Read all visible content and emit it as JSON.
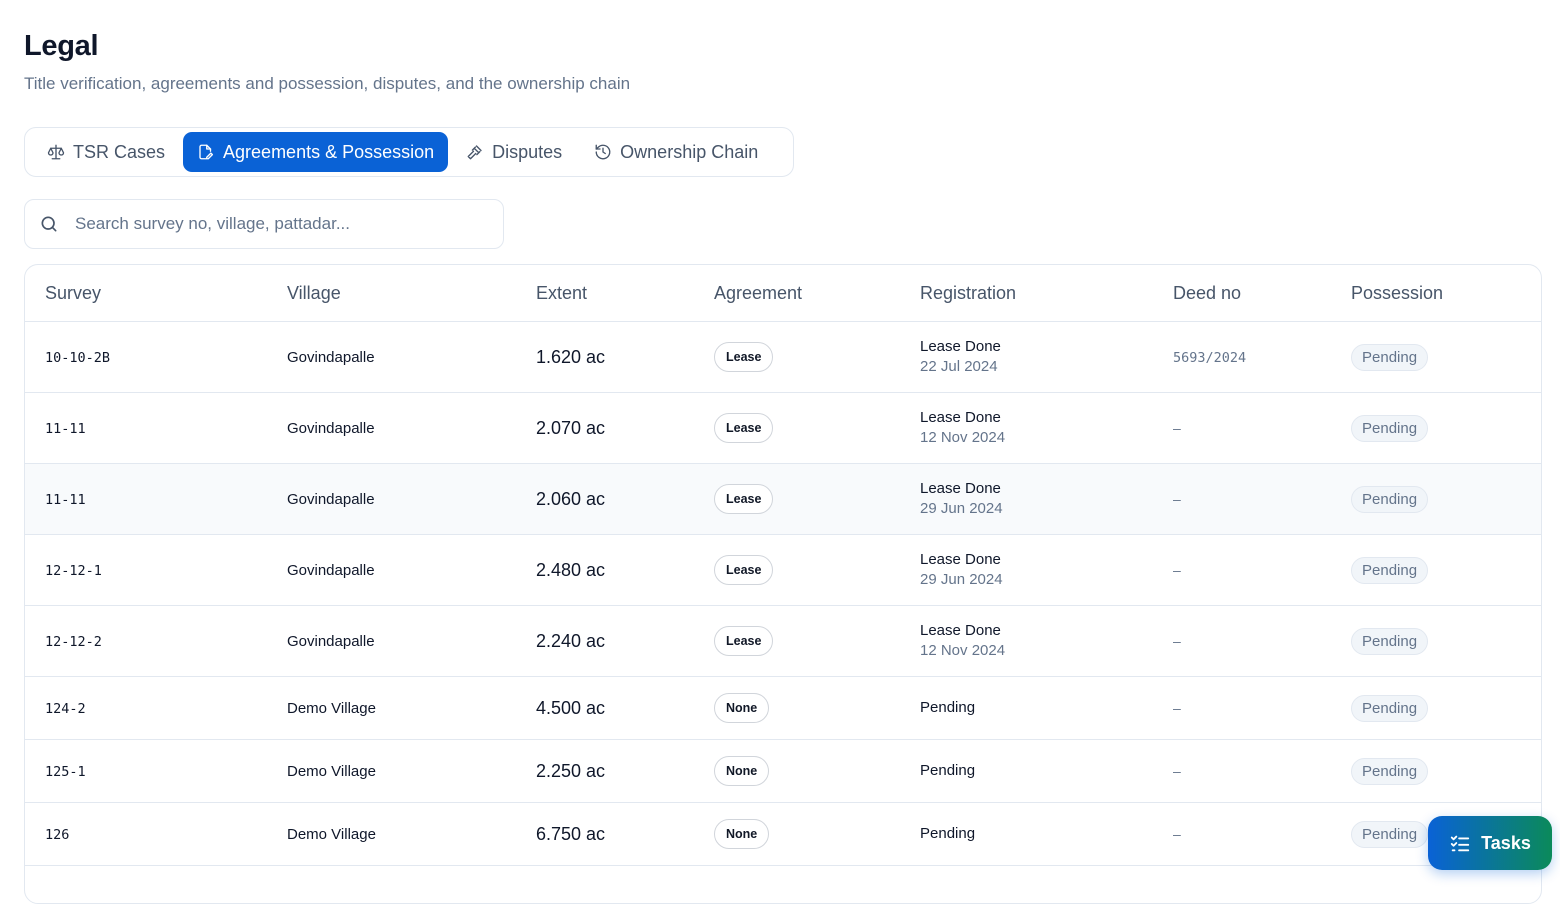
{
  "header": {
    "title": "Legal",
    "subtitle": "Title verification, agreements and possession, disputes, and the ownership chain"
  },
  "tabs": [
    {
      "label": "TSR Cases",
      "icon": "scale-icon",
      "active": false
    },
    {
      "label": "Agreements & Possession",
      "icon": "file-pen-icon",
      "active": true
    },
    {
      "label": "Disputes",
      "icon": "gavel-icon",
      "active": false
    },
    {
      "label": "Ownership Chain",
      "icon": "history-icon",
      "active": false
    }
  ],
  "search": {
    "placeholder": "Search survey no, village, pattadar...",
    "value": ""
  },
  "table": {
    "columns": [
      "Survey",
      "Village",
      "Extent",
      "Agreement",
      "Registration",
      "Deed no",
      "Possession"
    ],
    "rows": [
      {
        "survey": "10-10-2B",
        "village": "Govindapalle",
        "extent": "1.620 ac",
        "agreement": "Lease",
        "registration": "Lease Done",
        "reg_date": "22 Jul 2024",
        "deed": "5693/2024",
        "possession": "Pending"
      },
      {
        "survey": "11-11",
        "village": "Govindapalle",
        "extent": "2.070 ac",
        "agreement": "Lease",
        "registration": "Lease Done",
        "reg_date": "12 Nov 2024",
        "deed": "–",
        "possession": "Pending"
      },
      {
        "survey": "11-11",
        "village": "Govindapalle",
        "extent": "2.060 ac",
        "agreement": "Lease",
        "registration": "Lease Done",
        "reg_date": "29 Jun 2024",
        "deed": "–",
        "possession": "Pending"
      },
      {
        "survey": "12-12-1",
        "village": "Govindapalle",
        "extent": "2.480 ac",
        "agreement": "Lease",
        "registration": "Lease Done",
        "reg_date": "29 Jun 2024",
        "deed": "–",
        "possession": "Pending"
      },
      {
        "survey": "12-12-2",
        "village": "Govindapalle",
        "extent": "2.240 ac",
        "agreement": "Lease",
        "registration": "Lease Done",
        "reg_date": "12 Nov 2024",
        "deed": "–",
        "possession": "Pending"
      },
      {
        "survey": "124-2",
        "village": "Demo Village",
        "extent": "4.500 ac",
        "agreement": "None",
        "registration": "Pending",
        "reg_date": "",
        "deed": "–",
        "possession": "Pending"
      },
      {
        "survey": "125-1",
        "village": "Demo Village",
        "extent": "2.250 ac",
        "agreement": "None",
        "registration": "Pending",
        "reg_date": "",
        "deed": "–",
        "possession": "Pending"
      },
      {
        "survey": "126",
        "village": "Demo Village",
        "extent": "6.750 ac",
        "agreement": "None",
        "registration": "Pending",
        "reg_date": "",
        "deed": "–",
        "possession": "Pending"
      }
    ]
  },
  "tasks_button": {
    "label": "Tasks",
    "icon": "list-checks-icon"
  },
  "colors": {
    "accent": "#0a62d6",
    "accent_end": "#0b8a5a",
    "muted": "#64748b",
    "border": "#e2e8f0"
  }
}
